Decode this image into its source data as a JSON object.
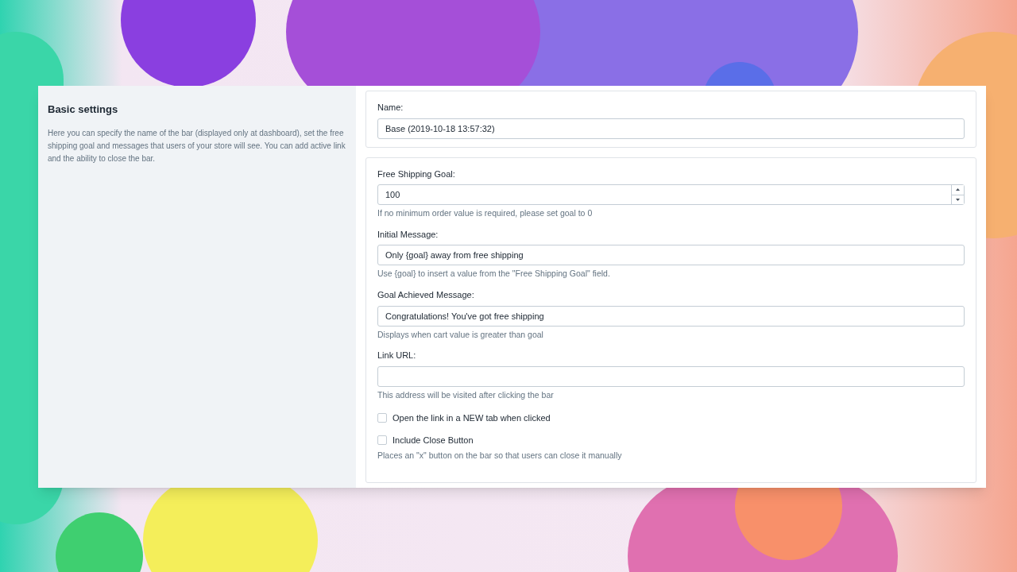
{
  "section": {
    "title": "Basic settings",
    "description": "Here you can specify the name of the bar (displayed only at dashboard), set the free shipping goal and messages that users of your store will see. You can add active link and the ability to close the bar."
  },
  "cards": [
    {
      "fields": [
        {
          "kind": "text",
          "label": "Name:",
          "value": "Base (2019-10-18 13:57:32)"
        }
      ]
    },
    {
      "fields": [
        {
          "kind": "number",
          "label": "Free Shipping Goal:",
          "value": "100",
          "help": "If no minimum order value is required, please set goal to 0"
        },
        {
          "kind": "text",
          "label": "Initial Message:",
          "value": "Only {goal} away from free shipping",
          "help": "Use {goal} to insert a value from the \"Free Shipping Goal\" field."
        },
        {
          "kind": "text",
          "label": "Goal Achieved Message:",
          "value": "Congratulations! You've got free shipping",
          "help": "Displays when cart value is greater than goal"
        },
        {
          "kind": "text",
          "label": "Link URL:",
          "help": "This address will be visited after clicking the bar"
        },
        {
          "kind": "checkbox",
          "label": "Open the link in a NEW tab when clicked",
          "checked": false
        },
        {
          "kind": "checkbox",
          "label": "Include Close Button",
          "checked": false,
          "help": "Places an \"x\" button on the bar so that users can close it manually"
        }
      ]
    }
  ]
}
